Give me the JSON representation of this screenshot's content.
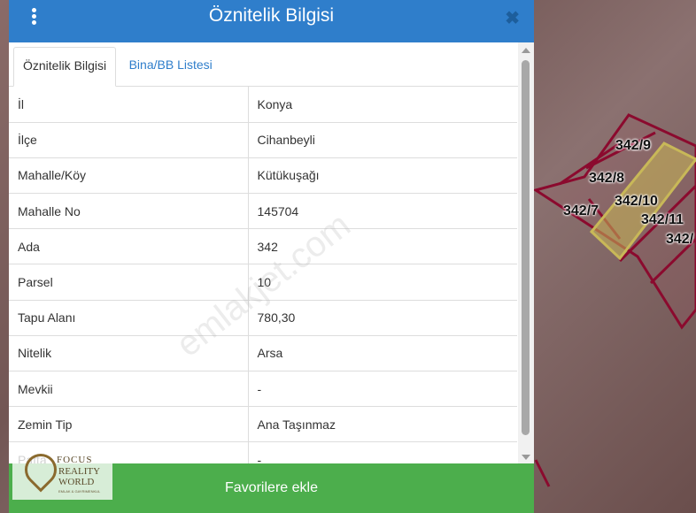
{
  "map": {
    "parcels": [
      "342/9",
      "342/8",
      "342/10",
      "342/7",
      "342/11",
      "342/"
    ]
  },
  "dialog": {
    "title": "Öznitelik Bilgisi",
    "tabs": [
      {
        "label": "Öznitelik Bilgisi"
      },
      {
        "label": "Bina/BB Listesi"
      }
    ],
    "rows": [
      {
        "key": "İl",
        "value": "Konya"
      },
      {
        "key": "İlçe",
        "value": "Cihanbeyli"
      },
      {
        "key": "Mahalle/Köy",
        "value": "Kütükuşağı"
      },
      {
        "key": "Mahalle No",
        "value": "145704"
      },
      {
        "key": "Ada",
        "value": "342"
      },
      {
        "key": "Parsel",
        "value": "10"
      },
      {
        "key": "Tapu Alanı",
        "value": "780,30"
      },
      {
        "key": "Nitelik",
        "value": "Arsa"
      },
      {
        "key": "Mevkii",
        "value": "-"
      },
      {
        "key": "Zemin Tip",
        "value": "Ana Taşınmaz"
      },
      {
        "key": "Pafta",
        "value": "-"
      }
    ],
    "favorite_button": "Favorilere ekle"
  },
  "watermark": "emlakjet.com",
  "logo": {
    "line1": "FOCUS",
    "line2": "REALITY",
    "line3": "WORLD",
    "line4": "EMLAK & GAYRIMENKUL"
  },
  "colors": {
    "header": "#2f7ecb",
    "button": "#4cae4c",
    "parcel_border": "#8b0a2e",
    "selected_parcel": "#c8b858"
  }
}
